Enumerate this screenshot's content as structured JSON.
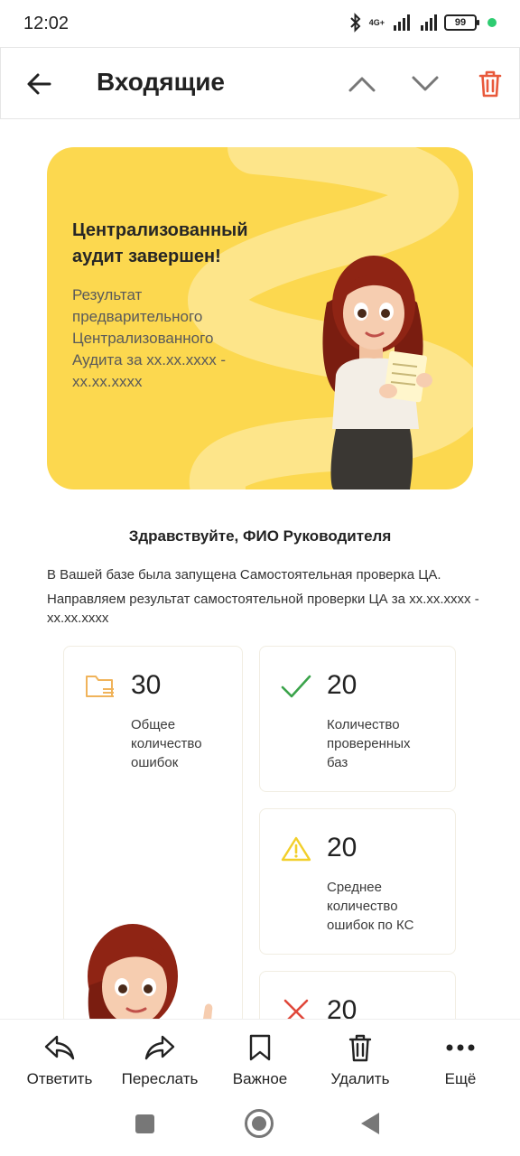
{
  "status": {
    "time": "12:02",
    "network": "4G+",
    "battery": "99"
  },
  "header": {
    "title": "Входящие",
    "icons": {
      "back": "arrow-left-icon",
      "prev": "chevron-up-icon",
      "next": "chevron-down-icon",
      "delete": "trash-icon"
    },
    "colors": {
      "delete": "#e8593b"
    }
  },
  "banner": {
    "title": "Централизованный аудит завершен!",
    "subtitle": "Результат предварительного Централизованного Аудита за  хх.хх.хххх - хх.хх.хххх",
    "colors": {
      "background": "#fcd84f"
    }
  },
  "greeting": "Здравствуйте, ФИО Руководителя",
  "intro": {
    "line1": "В Вашей базе была запущена Самостоятельная проверка ЦА.",
    "line2": "Направляем результат самостоятельной проверки ЦА за хх.хх.хххх - хх.хх.хххх"
  },
  "stats": [
    {
      "value": "30",
      "label": "Общее количество ошибок",
      "icon": "folder-icon"
    },
    {
      "value": "20",
      "label": "Количество проверенных баз",
      "icon": "check-icon"
    },
    {
      "value": "20",
      "label": "Среднее количество ошибок по КС",
      "icon": "warning-icon"
    },
    {
      "value": "20",
      "label": "",
      "icon": "cross-icon"
    }
  ],
  "actions": [
    {
      "label": "Ответить",
      "icon": "reply-icon"
    },
    {
      "label": "Переслать",
      "icon": "forward-icon"
    },
    {
      "label": "Важное",
      "icon": "bookmark-icon"
    },
    {
      "label": "Удалить",
      "icon": "trash-icon"
    },
    {
      "label": "Ещё",
      "icon": "more-icon"
    }
  ]
}
